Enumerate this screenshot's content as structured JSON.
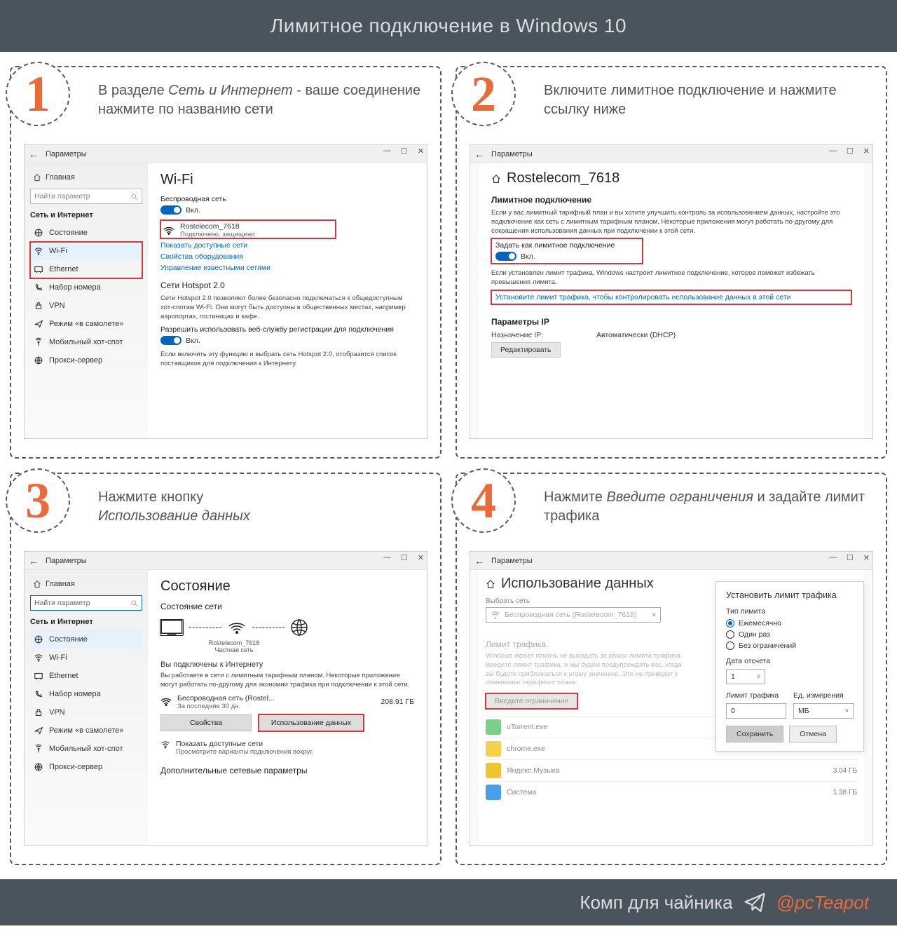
{
  "header": {
    "title": "Лимитное подключение в Windows 10"
  },
  "footer": {
    "text": "Комп для чайника",
    "handle": "@pcTeapot"
  },
  "steps": {
    "s1": {
      "num": "1",
      "text_pre": "В разделе ",
      "text_em": "Сеть и Интернет",
      "text_post": " - ваше соединение нажмите по названию сети"
    },
    "s2": {
      "num": "2",
      "text": "Включите лимитное подклю­чение и нажмите ссылку ниже"
    },
    "s3": {
      "num": "3",
      "text_pre": "Нажмите кнопку ",
      "text_em": "Использование данных"
    },
    "s4": {
      "num": "4",
      "text_pre": "Нажмите ",
      "text_em": "Введите ограничения",
      "text_post": " и задайте лимит трафика"
    }
  },
  "win_common": {
    "back": "←",
    "title": "Параметры",
    "ctrl_min": "—",
    "ctrl_max": "☐",
    "ctrl_close": "✕"
  },
  "sidebar": {
    "home": "Главная",
    "search_placeholder": "Найти параметр",
    "category": "Сеть и Интернет",
    "items": {
      "status": "Состояние",
      "wifi": "Wi-Fi",
      "ethernet": "Ethernet",
      "dial": "Набор номера",
      "vpn": "VPN",
      "airplane": "Режим «в самолете»",
      "hotspot": "Мобильный хот-спот",
      "proxy": "Прокси-сервер"
    }
  },
  "p1": {
    "h1": "Wi-Fi",
    "wireless_label": "Беспроводная сеть",
    "toggle": "Вкл.",
    "net_name": "Rostelecom_7618",
    "net_sub": "Подключено, защищено",
    "link_show": "Показать доступные сети",
    "link_hw": "Свойства оборудования",
    "link_known": "Управление известными сетями",
    "hs_title": "Сети Hotspot 2.0",
    "hs_desc": "Сети Hotspot 2.0 позволяют более безопасно подключаться к общедоступным хот-спотам Wi-Fi. Они могут быть доступны в общественных местах, например аэропортах, гостиницах и кафе.",
    "hs_allow": "Разрешить использовать веб-службу регистрации для подключения",
    "hs_toggle": "Вкл.",
    "hs_foot": "Если включить эту функцию и выбрать сеть Hotspot 2.0, отобразится список поставщиков для подключения к Интернету."
  },
  "p2": {
    "h1": "Rostelecom_7618",
    "h2": "Лимитное подключение",
    "desc": "Если у вас лимитный тарифный план и вы хотите улучшить контроль за использованием данных, настройте это подключение как сеть с лимитным тарифным планом. Некоторые приложения могут работать по-другому для сокращения использования данных при подключении к этой сети.",
    "toggle_label": "Задать как лимитное подключение",
    "toggle": "Вкл.",
    "foot1": "Если установлен лимит трафика, Windows настроит лимитное подключение, которое поможет избежать превышения лимита.",
    "link": "Установите лимит трафика, чтобы контролировать использование данных в этой сети",
    "ip_title": "Параметры IP",
    "ip_k": "Назначение IP:",
    "ip_v": "Автоматически (DHCP)",
    "edit": "Редактировать"
  },
  "p3": {
    "h1": "Состояние",
    "h2": "Состояние сети",
    "net_name": "Rostelecom_7618",
    "net_type": "Частная сеть",
    "conn_title": "Вы подключены к Интернету",
    "conn_desc": "Вы работаете в сети с лимитным тарифным планом. Некоторые приложения могут работать по-другому для экономии трафика при подключении к этой сети.",
    "row_name": "Беспроводная сеть (Rostel...",
    "row_sub": "За последние 30 дн.",
    "row_val": "208.91 ГБ",
    "btn_props": "Свойства",
    "btn_usage": "Использование данных",
    "show_title": "Показать доступные сети",
    "show_desc": "Просмотрите варианты подключения вокруг.",
    "adv_title": "Дополнительные сетевые параметры"
  },
  "p4": {
    "h1": "Использование данных",
    "pick_label": "Выбрать сеть",
    "pick_value": "Беспроводная сеть (Rostelecom_7618)",
    "limit_title": "Лимит трафика",
    "limit_desc": "Windows может помочь не выходить за рамки лимита трафика. Введите лимит трафика, и мы будем предупреждать вас, когда вы будете приближаться к этому значению. Это не приведет к изменению тарифного плана.",
    "enter_btn": "Введите ограничение",
    "apps": [
      {
        "name": "uTorrent.exe",
        "size": ""
      },
      {
        "name": "chrome.exe",
        "size": ""
      },
      {
        "name": "Яндекс.Музыка",
        "size": "3.04 ГБ"
      },
      {
        "name": "Система",
        "size": "1.38 ГБ"
      }
    ],
    "dialog": {
      "title": "Установить лимит трафика",
      "type_label": "Тип лимита",
      "opt_monthly": "Ежемесячно",
      "opt_once": "Один раз",
      "opt_unlim": "Без ограничений",
      "date_label": "Дата отсчета",
      "date_value": "1",
      "limit_label": "Лимит трафика",
      "limit_value": "0",
      "unit_label": "Ед. измерения",
      "unit_value": "МБ",
      "save": "Сохранить",
      "cancel": "Отмена"
    }
  }
}
